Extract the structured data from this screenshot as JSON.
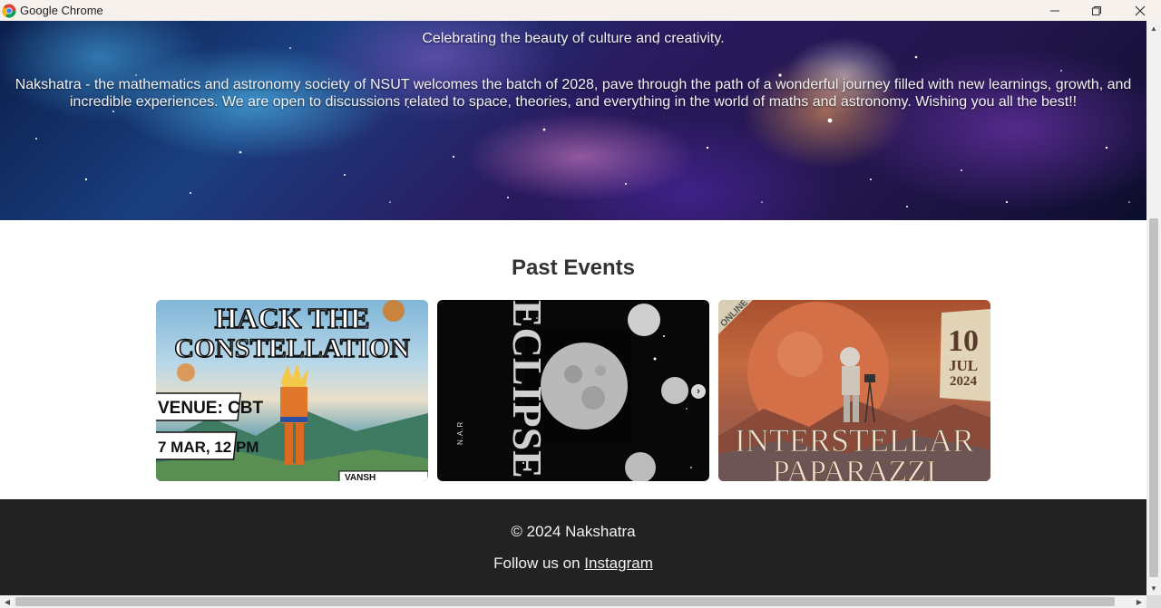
{
  "window": {
    "title": "Google Chrome",
    "icons": [
      "chrome-logo-icon",
      "minimize-icon",
      "maximize-icon",
      "close-icon"
    ]
  },
  "hero": {
    "tagline": "Celebrating the beauty of culture and creativity.",
    "description": "Nakshatra - the mathematics and astronomy society of NSUT welcomes the batch of 2028, pave through the path of a wonderful journey filled with new learnings, growth, and incredible experiences. We are open to discussions related to space, theories, and everything in the world of maths and astronomy. Wishing you all the best!!"
  },
  "past_events": {
    "title": "Past Events",
    "cards": [
      {
        "name": "hack-the-constellation",
        "title_line1": "HACK THE",
        "title_line2": "CONSTELLATION",
        "venue": "VENUE: CBT",
        "date": "7 MAR, 12 PM",
        "credit": "VANSH"
      },
      {
        "name": "eclipse",
        "vertical_text": "ECLIPSE",
        "small_text": "N.A.R"
      },
      {
        "name": "interstellar-paparazzi",
        "corner_text": "ONLINE",
        "day": "10",
        "month": "JUL",
        "year": "2024",
        "title_line1": "INTERSTELLAR",
        "title_line2": "PAPARAZZI"
      }
    ],
    "next_arrow": "›"
  },
  "footer": {
    "copyright": "© 2024 Nakshatra",
    "follow_text": "Follow us on ",
    "instagram_link": "Instagram"
  },
  "scrollbars": {
    "up_arrow": "▲",
    "down_arrow": "▼",
    "left_arrow": "◀",
    "right_arrow": "▶"
  },
  "colors": {
    "footer_bg": "#222222",
    "section_title": "#333333",
    "titlebar_bg": "#f7f1ee"
  }
}
